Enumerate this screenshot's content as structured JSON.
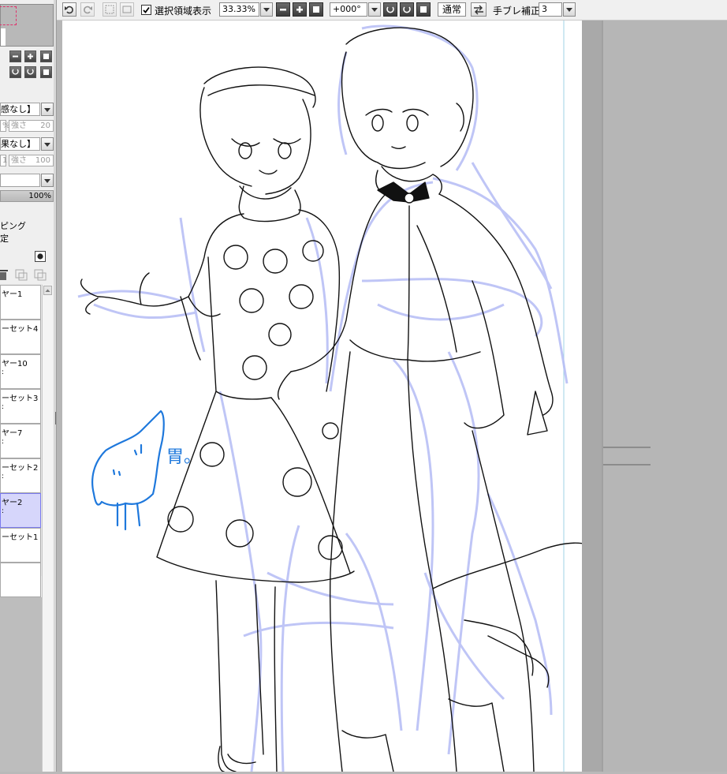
{
  "toolbar": {
    "selection_checkbox_label": "選択領域表示",
    "zoom_value": "33.33%",
    "rotation_value": "+000°",
    "blend_mode_label": "通常",
    "stabilizer_label": "手ブレ補正",
    "stabilizer_value": "3"
  },
  "left_panel": {
    "texture_option": "感なし】",
    "texture_strength_pct": "%",
    "texture_strength_label": "強さ",
    "texture_strength_value": "20",
    "effect_option": "果なし】",
    "effect_strength_pct": "1",
    "effect_strength_label": "強さ",
    "effect_strength_value": "100",
    "opacity_value": "100%",
    "clipping_label": "ピング",
    "lock_label": "定",
    "layers": [
      {
        "name": "ヤー1",
        "sub": "",
        "selected": false
      },
      {
        "name": "ーセット4",
        "sub": "",
        "selected": false
      },
      {
        "name": "ヤー10",
        "sub": "",
        "selected": false
      },
      {
        "name": "ーセット3",
        "sub": "",
        "selected": false
      },
      {
        "name": "ヤー7",
        "sub": "",
        "selected": false
      },
      {
        "name": "ーセット2",
        "sub": "",
        "selected": false
      },
      {
        "name": "ヤー2",
        "sub": "",
        "selected": true
      },
      {
        "name": "ーセット1",
        "sub": "",
        "selected": false
      },
      {
        "name": "",
        "sub": "",
        "selected": false
      }
    ]
  },
  "canvas": {
    "annotation_text": "胃。",
    "sketch_color": "#1e78dc",
    "draft_color": "#b4bcf5",
    "lineart_color": "#111111"
  }
}
